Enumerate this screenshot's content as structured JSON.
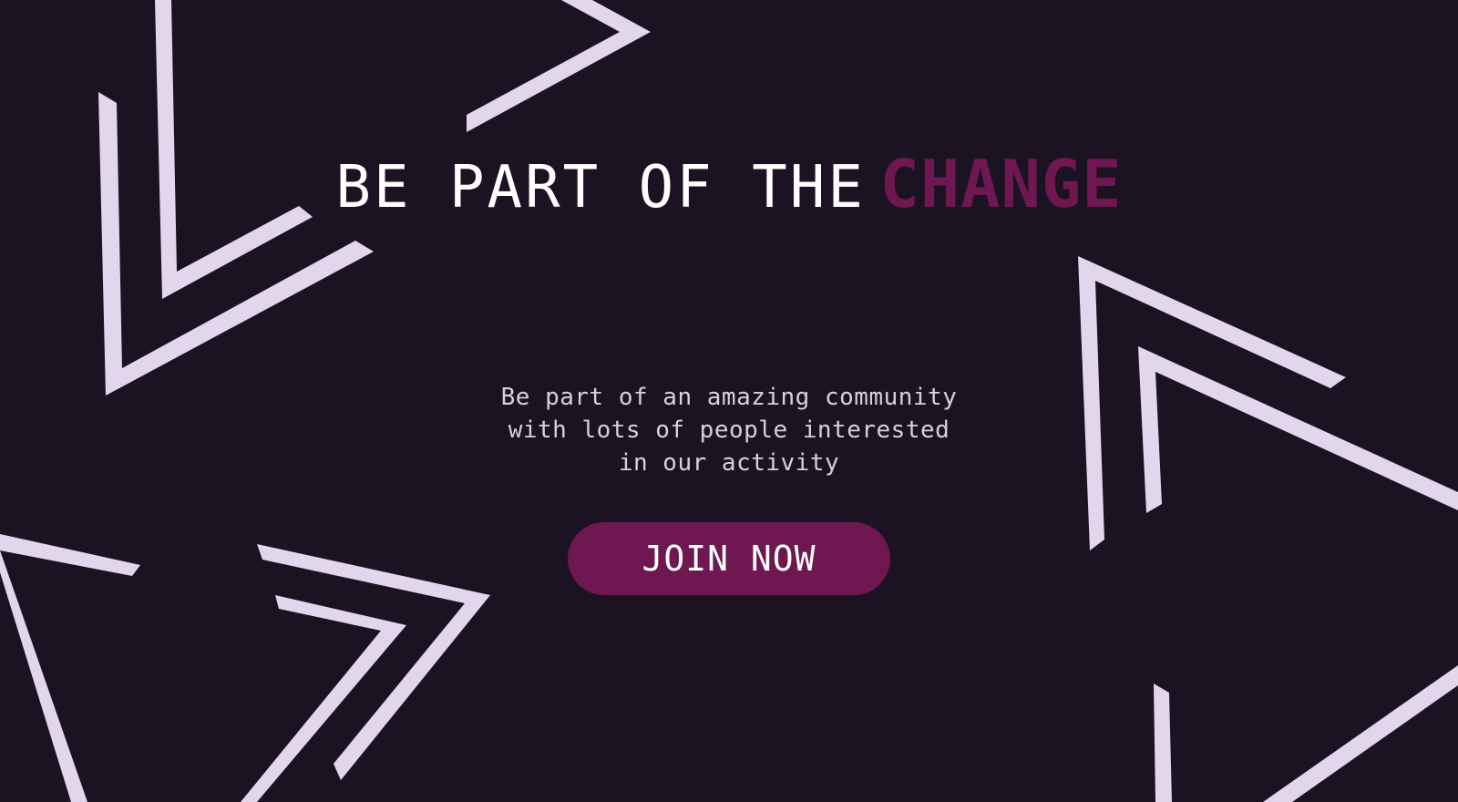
{
  "hero": {
    "headline_plain": "BE PART OF THE",
    "headline_accent": "CHANGE",
    "subtitle_lines": [
      "Be part of an amazing community",
      "with lots of people interested",
      "in our activity"
    ]
  },
  "cta": {
    "label": "JOIN NOW"
  },
  "colors": {
    "background": "#1c1322",
    "accent": "#6e1751",
    "shape_stroke": "#e2d6ec",
    "text_primary": "#ffffff",
    "text_secondary": "#d8cfe0"
  }
}
